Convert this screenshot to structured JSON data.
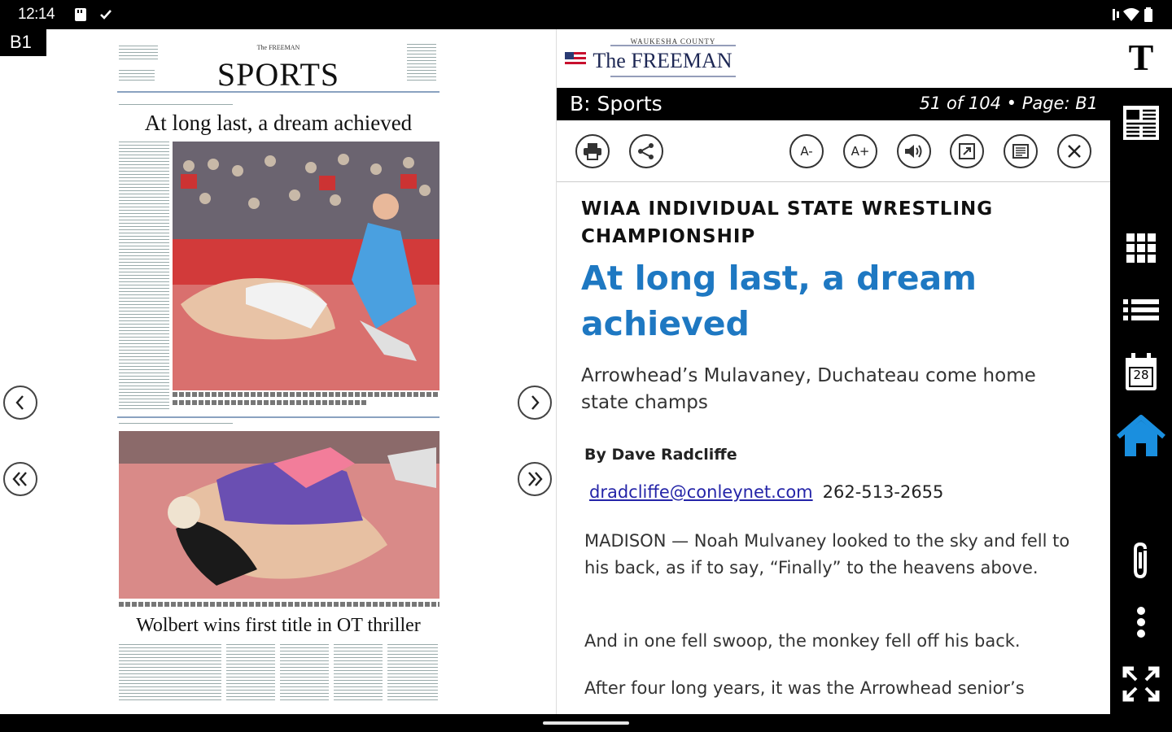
{
  "status_bar": {
    "time": "12:14"
  },
  "page_indicator": "B1",
  "newspaper_page": {
    "masthead_small": "The FREEMAN",
    "section_title": "SPORTS",
    "headline_1": "At long last, a dream achieved",
    "deck_1": "Arrowhead's Mulvaney, Duchateau come home state champs",
    "headline_2": "Wolbert wins first title in OT thriller"
  },
  "paper": {
    "county_line": "WAUKESHA COUNTY",
    "name": "The FREEMAN"
  },
  "section_bar": {
    "section": "B: Sports",
    "position": "51 of 104 • Page: B1"
  },
  "tools": {
    "font_smaller": "A-",
    "font_larger": "A+"
  },
  "article": {
    "kicker": "WIAA INDIVIDUAL STATE WRESTLING CHAMPIONSHIP",
    "title": "At long last, a dream achieved",
    "deck": "Arrowhead’s Mulavaney, Duchateau come home state champs",
    "byline": "By Dave Radcliffe",
    "email": "dradcliffe@conleynet.com",
    "phone": "262-513-2655",
    "paragraphs": [
      "MADISON — Noah Mulvaney looked to the sky and fell to his back, as if to say, “Finally” to the heavens above.",
      "And in one fell swoop, the monkey fell off his back.",
      "After four long years, it was the Arrowhead senior’s"
    ]
  },
  "toolbar": {
    "calendar_day": "28"
  },
  "colors": {
    "accent_blue": "#1e78c2",
    "home_blue": "#1a8fdf",
    "link_blue": "#2424a8"
  }
}
